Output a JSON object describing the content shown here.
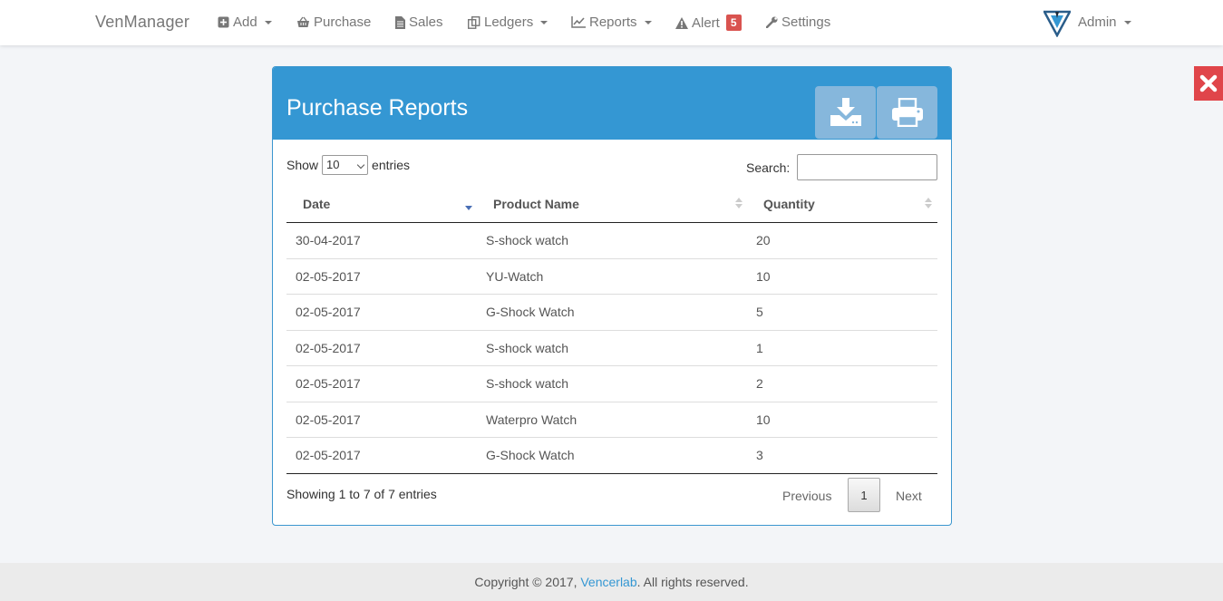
{
  "navbar": {
    "brand": "VenManager",
    "items": [
      {
        "label": "Add",
        "icon": "plus-square-icon",
        "dropdown": true
      },
      {
        "label": "Purchase",
        "icon": "basket-icon",
        "dropdown": false
      },
      {
        "label": "Sales",
        "icon": "file-text-icon",
        "dropdown": false
      },
      {
        "label": "Ledgers",
        "icon": "copy-icon",
        "dropdown": true
      },
      {
        "label": "Reports",
        "icon": "line-chart-icon",
        "dropdown": true
      },
      {
        "label": "Alert",
        "icon": "warning-icon",
        "dropdown": false,
        "badge": "5"
      },
      {
        "label": "Settings",
        "icon": "wrench-icon",
        "dropdown": false
      }
    ],
    "user": "Admin"
  },
  "panel": {
    "title": "Purchase Reports",
    "show_label": "Show",
    "entries_value": "10",
    "entries_label": "entries",
    "search_label": "Search:",
    "search_value": ""
  },
  "table": {
    "columns": [
      "Date",
      "Product Name",
      "Quantity"
    ],
    "rows": [
      {
        "date": "30-04-2017",
        "product": "S-shock watch",
        "qty": "20"
      },
      {
        "date": "02-05-2017",
        "product": "YU-Watch",
        "qty": "10"
      },
      {
        "date": "02-05-2017",
        "product": "G-Shock Watch",
        "qty": "5"
      },
      {
        "date": "02-05-2017",
        "product": "S-shock watch",
        "qty": "1"
      },
      {
        "date": "02-05-2017",
        "product": "S-shock watch",
        "qty": "2"
      },
      {
        "date": "02-05-2017",
        "product": "Waterpro Watch",
        "qty": "10"
      },
      {
        "date": "02-05-2017",
        "product": "G-Shock Watch",
        "qty": "3"
      }
    ]
  },
  "pagination": {
    "info": "Showing 1 to 7 of 7 entries",
    "previous": "Previous",
    "current": "1",
    "next": "Next"
  },
  "footer": {
    "prefix": "Copyright © 2017,",
    "link": "Vencerlab",
    "suffix": ". All rights reserved."
  },
  "colors": {
    "accent": "#3497d3",
    "alert_badge": "#d9534f",
    "close": "#e0454a"
  }
}
